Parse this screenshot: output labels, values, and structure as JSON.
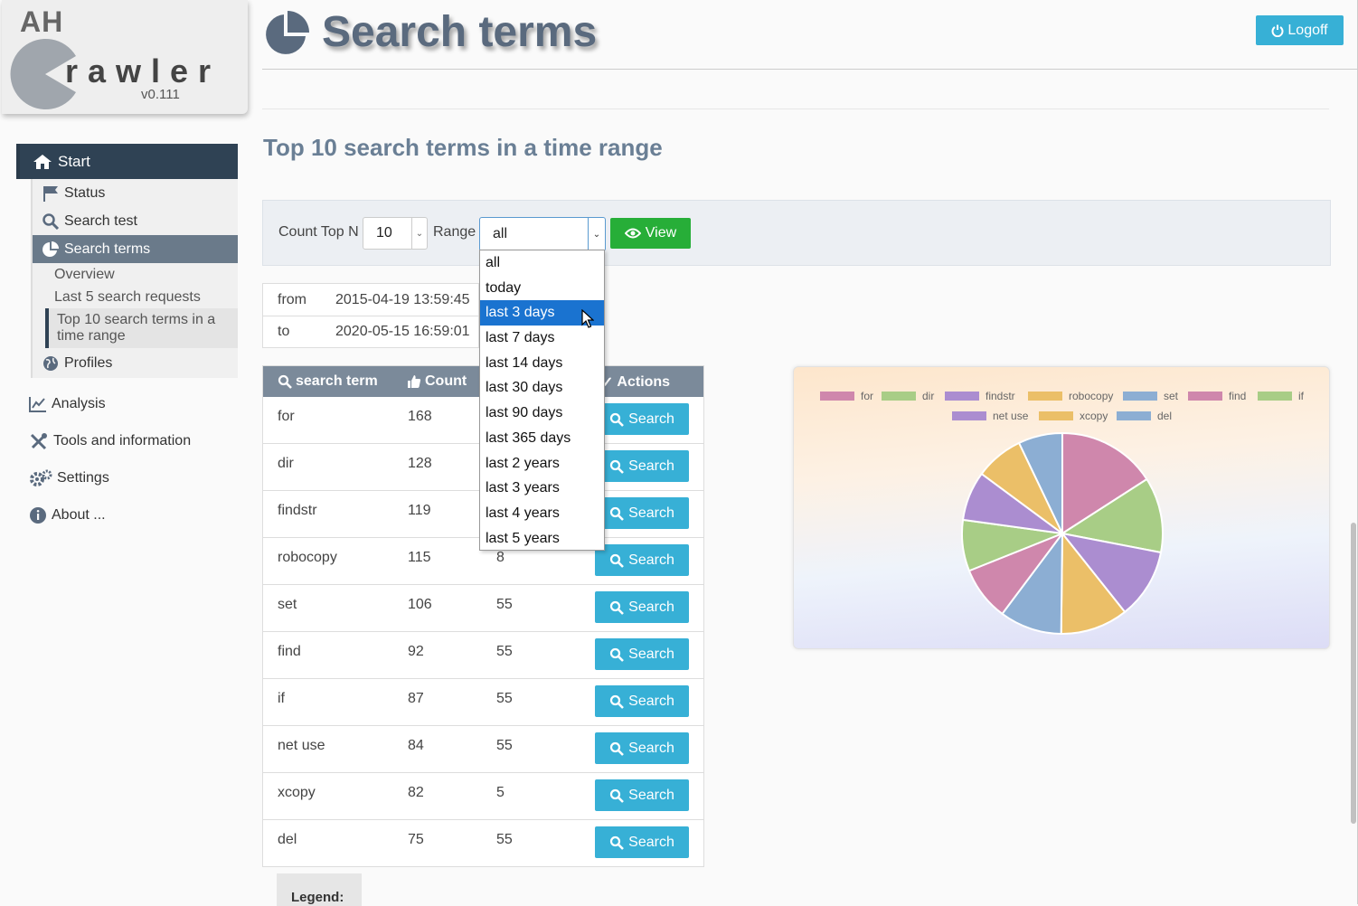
{
  "logo": {
    "ah": "AH",
    "rawler": "rawler",
    "version": "v0.111"
  },
  "header": {
    "title": "Search terms",
    "logoff_label": "Logoff"
  },
  "nav": {
    "start": "Start",
    "status": "Status",
    "search_test": "Search test",
    "search_terms": "Search terms",
    "overview": "Overview",
    "last5": "Last 5 search requests",
    "top10": "Top 10 search terms in a time range",
    "profiles": "Profiles",
    "analysis": "Analysis",
    "tools": "Tools and information",
    "settings": "Settings",
    "about": "About ..."
  },
  "section_title": "Top 10 search terms in a time range",
  "controls": {
    "count_label": "Count Top N",
    "count_value": "10",
    "range_label": "Range",
    "range_value": "all",
    "view_label": "View",
    "range_options": [
      "all",
      "today",
      "last 3 days",
      "last 7 days",
      "last 14 days",
      "last 30 days",
      "last 90 days",
      "last 365 days",
      "last 2 years",
      "last 3 years",
      "last 4 years",
      "last 5 years"
    ],
    "highlighted_option": "last 3 days"
  },
  "range": {
    "from_label": "from",
    "from_value": "2015-04-19 13:59:45",
    "to_label": "to",
    "to_value": "2020-05-15 16:59:01"
  },
  "table": {
    "headers": {
      "term": "search term",
      "count": "Count",
      "actions": "Actions"
    },
    "search_label": "Search",
    "rows": [
      {
        "term": "for",
        "count": "168",
        "third": ""
      },
      {
        "term": "dir",
        "count": "128",
        "third": ""
      },
      {
        "term": "findstr",
        "count": "119",
        "third": ""
      },
      {
        "term": "robocopy",
        "count": "115",
        "third": "8"
      },
      {
        "term": "set",
        "count": "106",
        "third": "55"
      },
      {
        "term": "find",
        "count": "92",
        "third": "55"
      },
      {
        "term": "if",
        "count": "87",
        "third": "55"
      },
      {
        "term": "net use",
        "count": "84",
        "third": "55"
      },
      {
        "term": "xcopy",
        "count": "82",
        "third": "5"
      },
      {
        "term": "del",
        "count": "75",
        "third": "55"
      }
    ]
  },
  "legend": {
    "label": "Legend:"
  },
  "chart_data": {
    "type": "pie",
    "categories": [
      "for",
      "dir",
      "findstr",
      "robocopy",
      "set",
      "find",
      "if",
      "net use",
      "xcopy",
      "del"
    ],
    "values": [
      168,
      128,
      119,
      115,
      106,
      92,
      87,
      84,
      82,
      75
    ],
    "colors": [
      "#cf87ac",
      "#a8cd86",
      "#ab8dd0",
      "#ebbf68",
      "#8caed3",
      "#cf87ac",
      "#a8cd86",
      "#ab8dd0",
      "#ebbf68",
      "#8caed3"
    ],
    "legend_position": "top"
  },
  "colors": {
    "nav_dark": "#2f4254",
    "accent_blue": "#37b0d6",
    "view_green": "#27ae38",
    "title_slate": "#5a6a7e"
  }
}
